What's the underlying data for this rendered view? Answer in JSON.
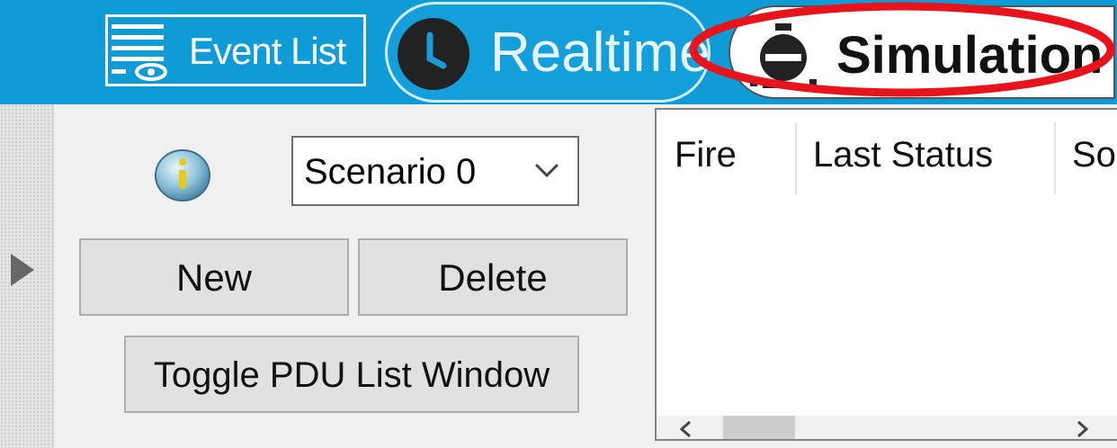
{
  "tabs": {
    "event_list": {
      "label": "Event List",
      "icon": "list-icon"
    },
    "realtime": {
      "label": "Realtime",
      "icon": "clock-icon"
    },
    "simulation": {
      "label": "Simulation",
      "icon": "simulation-icon"
    }
  },
  "scenario": {
    "selected": "Scenario 0",
    "info_icon": "info-icon"
  },
  "buttons": {
    "new": "New",
    "delete": "Delete",
    "toggle_pdu": "Toggle PDU List Window"
  },
  "table": {
    "columns": [
      "Fire",
      "Last Status",
      "So"
    ]
  },
  "colors": {
    "topbar": "#0e9bd6",
    "highlight": "#e8141c",
    "button_bg": "#e1e1e1"
  }
}
